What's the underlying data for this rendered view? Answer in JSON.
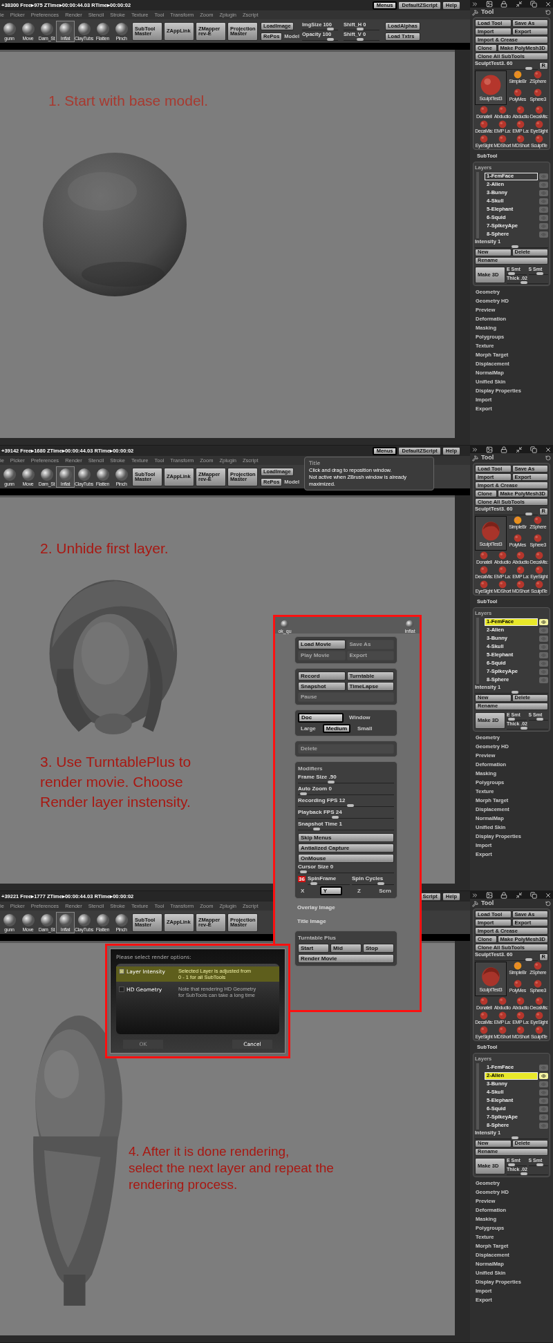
{
  "steps": [
    {
      "status": "+38300 Free▸975 ZTime▸00:00:44.03 RTime▸00:00:02",
      "top_buttons": [
        {
          "label": "Menus",
          "selected": true
        },
        {
          "label": "DefaultZScript",
          "selected": false
        },
        {
          "label": "Help",
          "selected": false
        }
      ],
      "menu": [
        "ie",
        "Picker",
        "Preferences",
        "Render",
        "Stencil",
        "Stroke",
        "Texture",
        "Tool",
        "Transform",
        "Zoom",
        "Zplugin",
        "Zscript"
      ],
      "toolbar": {
        "brushes": [
          {
            "label": "gunn",
            "selected": false
          },
          {
            "label": "Move",
            "selected": false
          },
          {
            "label": "Dam_St",
            "selected": false
          },
          {
            "label": "Inflat",
            "selected": true
          },
          {
            "label": "ClayTubs",
            "selected": false
          },
          {
            "label": "Flatten",
            "selected": false
          },
          {
            "label": "Pinch",
            "selected": false
          }
        ],
        "plugins": [
          "SubTool\nMaster",
          "ZAppLink",
          "ZMapper\nrev-E",
          "Projection\nMaster"
        ],
        "image_buttons": [
          "LoadImage",
          "RePos"
        ],
        "model_label": "Model",
        "sliders": [
          {
            "label": "ImgSize 100",
            "level": 0.85
          },
          {
            "label": "Opacity 100",
            "level": 0.85
          },
          {
            "label": "Shift_H 0",
            "level": 0.45
          },
          {
            "label": "Shift_V 0",
            "level": 0.45
          }
        ],
        "texture_buttons": [
          "LoadAlphas",
          "Load Txtrs"
        ]
      },
      "picture": {
        "kind": "sphere"
      },
      "captions": [
        "1. Start with base model."
      ],
      "tool_panel": {
        "title": "Tool",
        "buttons": [
          [
            "Load Tool",
            "Save As"
          ],
          [
            "Import",
            "Export"
          ],
          [
            "Import & Crease"
          ],
          [
            "Clone",
            "Make PolyMesh3D"
          ],
          [
            "Clone All SubTools"
          ]
        ],
        "tool_slider": {
          "label": "SculptTest3. 60",
          "level": 0.9
        },
        "reset": "R",
        "current_tool": {
          "label": "SculptTest3",
          "kind": "sphere"
        },
        "thumbnails": [
          "SimpleBr",
          "ZSphere",
          "PolyMes",
          "Sphere3",
          "Donatell",
          "Abductio",
          "Abductio",
          "DecaMis:",
          "DecaMis:",
          "EMP La:",
          "EMP La:",
          "EyeSight",
          "EyeSight",
          "MDShort",
          "MDShort",
          "SculptTe"
        ],
        "subtool": "SubTool",
        "layers_title": "Layers",
        "layers": [
          {
            "label": "1-FemFace",
            "selected": true,
            "on": false
          },
          {
            "label": "2-Alien",
            "selected": false,
            "on": false
          },
          {
            "label": "3-Bunny",
            "selected": false,
            "on": false
          },
          {
            "label": "4-Skull",
            "selected": false,
            "on": false
          },
          {
            "label": "5-Elephant",
            "selected": false,
            "on": false
          },
          {
            "label": "6-Squid",
            "selected": false,
            "on": false
          },
          {
            "label": "7-SpikeyApe",
            "selected": false,
            "on": false
          },
          {
            "label": "8-Sphere",
            "selected": false,
            "on": false
          }
        ],
        "intensity": {
          "label": "Intensity 1",
          "level": 0.55
        },
        "layer_buttons": [
          "New",
          "Delete"
        ],
        "rename": "Rename",
        "make3d": "Make 3D",
        "smooth_sliders": [
          {
            "label": "E Smt",
            "level": 0.1
          },
          {
            "label": "S Smt",
            "level": 0.6
          }
        ],
        "thick": {
          "label": "Thick .02",
          "level": 0.4
        },
        "sections": [
          "Geometry",
          "Geometry HD",
          "Preview",
          "Deformation",
          "Masking",
          "Polygroups",
          "Texture",
          "Morph Target",
          "Displacement",
          "NormalMap",
          "Unified Skin",
          "Display Properties",
          "Import",
          "Export"
        ]
      }
    },
    {
      "status": "+39142 Free▸1680 ZTime▸00:00:44.03 RTime▸00:00:02",
      "top_buttons": [
        {
          "label": "Menus",
          "selected": true
        },
        {
          "label": "DefaultZScript",
          "selected": false
        },
        {
          "label": "Help",
          "selected": false
        }
      ],
      "menu": [
        "ie",
        "Picker",
        "Preferences",
        "Render",
        "Stencil",
        "Stroke",
        "Texture",
        "Tool",
        "Transform",
        "Zoom",
        "Zplugin",
        "Zscript"
      ],
      "toolbar": {
        "brushes": [
          {
            "label": "gunn",
            "selected": false
          },
          {
            "label": "Move",
            "selected": false
          },
          {
            "label": "Dam_St",
            "selected": false
          },
          {
            "label": "Inflat",
            "selected": true
          },
          {
            "label": "ClayTubs",
            "selected": false
          },
          {
            "label": "Flatten",
            "selected": false
          },
          {
            "label": "Pinch",
            "selected": false
          }
        ],
        "plugins": [
          "SubTool\nMaster",
          "ZAppLink",
          "ZMapper\nrev-E",
          "Projection\nMaster"
        ],
        "image_buttons": [
          "LoadImage",
          "RePos"
        ],
        "model_label": "Model"
      },
      "tooltip": {
        "title": "Title",
        "text": "Click and drag to reposition window.\nNot active when ZBrush window is already\nmaximized."
      },
      "picture": {
        "kind": "head"
      },
      "captions": [
        "2. Unhide first layer.",
        "3. Use TurntablePlus to\nrender movie. Choose\nRender layer instensity."
      ],
      "tool_panel": {
        "title": "Tool",
        "buttons": [
          [
            "Load Tool",
            "Save As"
          ],
          [
            "Import",
            "Export"
          ],
          [
            "Import & Crease"
          ],
          [
            "Clone",
            "Make PolyMesh3D"
          ],
          [
            "Clone All SubTools"
          ]
        ],
        "tool_slider": {
          "label": "SculptTest3. 60",
          "level": 0.9
        },
        "reset": "R",
        "current_tool": {
          "label": "SculptTest3",
          "kind": "head"
        },
        "thumbnails": [
          "SimpleBr",
          "ZSphere",
          "PolyMes",
          "Sphere3",
          "Donatell",
          "Abductio",
          "Abductio",
          "DecaMis:",
          "DecaMis:",
          "EMP La:",
          "EMP La:",
          "EyeSight",
          "EyeSight",
          "MDShort",
          "MDShort",
          "SculptTe"
        ],
        "subtool": "SubTool",
        "layers_title": "Layers",
        "layers": [
          {
            "label": "1-FemFace",
            "selected": true,
            "on": true
          },
          {
            "label": "2-Alien",
            "selected": false,
            "on": false
          },
          {
            "label": "3-Bunny",
            "selected": false,
            "on": false
          },
          {
            "label": "4-Skull",
            "selected": false,
            "on": false
          },
          {
            "label": "5-Elephant",
            "selected": false,
            "on": false
          },
          {
            "label": "6-Squid",
            "selected": false,
            "on": false
          },
          {
            "label": "7-SpikeyApe",
            "selected": false,
            "on": false
          },
          {
            "label": "8-Sphere",
            "selected": false,
            "on": false
          }
        ],
        "intensity": {
          "label": "Intensity 1",
          "level": 0.55
        },
        "layer_buttons": [
          "New",
          "Delete"
        ],
        "rename": "Rename",
        "make3d": "Make 3D",
        "smooth_sliders": [
          {
            "label": "E Smt",
            "level": 0.1
          },
          {
            "label": "S Smt",
            "level": 0.6
          }
        ],
        "thick": {
          "label": "Thick .02",
          "level": 0.4
        },
        "sections": [
          "Geometry",
          "Geometry HD",
          "Preview",
          "Deformation",
          "Masking",
          "Polygroups",
          "Texture",
          "Morph Target",
          "Displacement",
          "NormalMap",
          "Unified Skin",
          "Display Properties",
          "Import",
          "Export"
        ]
      }
    },
    {
      "status": "+39221 Free▸1777 ZTime▸00:00:44.03 RTime▸00:00:02",
      "top_buttons": [
        {
          "label": "Script",
          "selected": false
        },
        {
          "label": "Help",
          "selected": false
        }
      ],
      "menu": [
        "ie",
        "Picker",
        "Preferences",
        "Render",
        "Stencil",
        "Stroke",
        "Texture",
        "Tool",
        "Transform",
        "Zoom",
        "Zplugin",
        "Zscript"
      ],
      "toolbar": {
        "brushes": [
          {
            "label": "gunn",
            "selected": false
          },
          {
            "label": "Move",
            "selected": false
          },
          {
            "label": "Dam_St",
            "selected": false
          },
          {
            "label": "Inflat",
            "selected": true
          },
          {
            "label": "ClayTubs",
            "selected": false
          },
          {
            "label": "Flatten",
            "selected": false
          },
          {
            "label": "Pinch",
            "selected": false
          }
        ],
        "plugins": [
          "SubTool\nMaster",
          "ZAppLink",
          "ZMapper\nrev-E",
          "Projection\nMaster"
        ]
      },
      "picture": {
        "kind": "alien"
      },
      "captions": [
        "4. After it is done rendering,\nselect the next layer and repeat the\nrendering process."
      ],
      "tool_panel": {
        "title": "Tool",
        "buttons": [
          [
            "Load Tool",
            "Save As"
          ],
          [
            "Import",
            "Export"
          ],
          [
            "Import & Crease"
          ],
          [
            "Clone",
            "Make PolyMesh3D"
          ],
          [
            "Clone All SubTools"
          ]
        ],
        "tool_slider": {
          "label": "SculptTest3. 60",
          "level": 0.9
        },
        "reset": "R",
        "current_tool": {
          "label": "SculptTest3",
          "kind": "head"
        },
        "thumbnails": [
          "SimpleBr",
          "ZSphere",
          "PolyMes",
          "Sphere3",
          "Donatell",
          "Abductio",
          "Abductio",
          "DecaMis:",
          "DecaMis:",
          "EMP La:",
          "EMP La:",
          "EyeSight",
          "EyeSight",
          "MDShort",
          "MDShort",
          "SculptTe"
        ],
        "subtool": "SubTool",
        "layers_title": "Layers",
        "layers": [
          {
            "label": "1-FemFace",
            "selected": false,
            "on": false
          },
          {
            "label": "2-Alien",
            "selected": true,
            "on": true
          },
          {
            "label": "3-Bunny",
            "selected": false,
            "on": false
          },
          {
            "label": "4-Skull",
            "selected": false,
            "on": false
          },
          {
            "label": "5-Elephant",
            "selected": false,
            "on": false
          },
          {
            "label": "6-Squid",
            "selected": false,
            "on": false
          },
          {
            "label": "7-SpikeyApe",
            "selected": false,
            "on": false
          },
          {
            "label": "8-Sphere",
            "selected": false,
            "on": false
          }
        ],
        "intensity": {
          "label": "Intensity 1",
          "level": 0.55
        },
        "layer_buttons": [
          "New",
          "Delete"
        ],
        "rename": "Rename",
        "make3d": "Make 3D",
        "smooth_sliders": [
          {
            "label": "E Smt",
            "level": 0.1
          },
          {
            "label": "S Smt",
            "level": 0.6
          }
        ],
        "thick": {
          "label": "Thick .02",
          "level": 0.4
        },
        "sections": [
          "Geometry",
          "Geometry HD",
          "Preview",
          "Deformation",
          "Masking",
          "Polygroups",
          "Texture",
          "Morph Target",
          "Displacement",
          "NormalMap",
          "Unified Skin",
          "Display Properties",
          "Import",
          "Export"
        ]
      }
    }
  ],
  "turntable_popup": {
    "backdrop_brushes": [
      "ok_qu",
      "Inflat"
    ],
    "movie_buttons": [
      {
        "label": "Load Movie",
        "disabled": false
      },
      {
        "label": "Save As",
        "disabled": true
      },
      {
        "label": "Play Movie",
        "disabled": true
      },
      {
        "label": "Export",
        "disabled": true
      }
    ],
    "record_buttons": [
      "Record",
      "Turntable",
      "Snapshot",
      "TimeLapse"
    ],
    "pause": {
      "label": "Pause",
      "disabled": true
    },
    "source_options": [
      {
        "label": "Doc",
        "selected": true
      },
      {
        "label": "Window",
        "selected": false
      }
    ],
    "size_options": [
      {
        "label": "Large",
        "selected": false
      },
      {
        "label": "Medium",
        "selected": true
      },
      {
        "label": "Small",
        "selected": false
      }
    ],
    "delete": {
      "label": "Delete",
      "disabled": true
    },
    "modifiers_title": "Modifiers",
    "sliders": [
      {
        "label": "Frame Size .50",
        "level": 0.33
      },
      {
        "label": "Auto Zoom 0",
        "level": 0.02
      },
      {
        "label": "Recording FPS 12",
        "level": 0.55
      },
      {
        "label": "Playback FPS 24",
        "level": 0.38
      },
      {
        "label": "Snapshot Time 1",
        "level": 0.17
      }
    ],
    "toggles": [
      "Skip Menus",
      "Antialized Capture",
      "OnMouse"
    ],
    "cursor_slider": {
      "label": "Cursor Size 0",
      "level": 0.02
    },
    "spin_badge": "36",
    "spin_sliders": [
      {
        "label": "SpinFrame",
        "level": 0.08
      },
      {
        "label": "Spin Cycles",
        "level": 0.72
      }
    ],
    "axes": [
      {
        "label": "X",
        "selected": false
      },
      {
        "label": "Y",
        "selected": true
      },
      {
        "label": "Z",
        "selected": false
      },
      {
        "label": "Scrn",
        "selected": false
      }
    ],
    "images": [
      "Overlay Image",
      "Title Image"
    ],
    "turntable_plus_title": "Turntable Plus",
    "turntable_buttons": [
      "Start",
      "Mid",
      "Stop"
    ],
    "render_button": "Render Movie"
  },
  "render_dialog": {
    "prompt": "Please select render options:",
    "options": [
      {
        "label": "Layer Intensity",
        "note": "Selected Layer is adjusted from\n0 - 1 for all SubTools",
        "checked": true
      },
      {
        "label": "HD Geometry",
        "note": "Note that rendering HD Geometry\nfor SubTools can take a long time",
        "checked": false
      }
    ],
    "buttons": [
      {
        "label": "OK",
        "disabled": true
      },
      {
        "label": "Cancel",
        "disabled": false
      }
    ]
  }
}
